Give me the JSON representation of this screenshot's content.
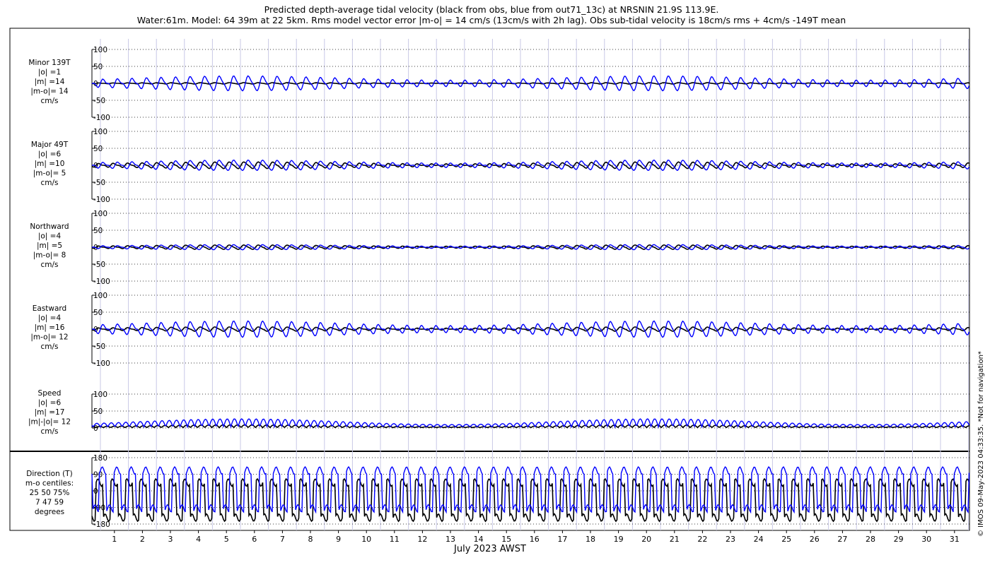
{
  "title_line1": "Predicted depth-average tidal velocity (black from obs, blue from out71_13c) at NRSNIN 21.9S 113.9E.",
  "title_line2": "Water:61m. Model: 64 39m at 22 5km. Rms model vector error |m-o| = 14 cm/s (13cm/s with 2h lag). Obs sub-tidal velocity is 18cm/s rms + 4cm/s -149T mean",
  "credit": "© IMOS 09-May-2023 04:33:35. *Not for navigation*",
  "chart_data": {
    "type": "line",
    "xlabel": "July 2023 AWST",
    "x_ticks": [
      "1",
      "2",
      "3",
      "4",
      "5",
      "6",
      "7",
      "8",
      "9",
      "10",
      "11",
      "12",
      "13",
      "14",
      "15",
      "16",
      "17",
      "18",
      "19",
      "20",
      "21",
      "22",
      "23",
      "24",
      "25",
      "26",
      "27",
      "28",
      "29",
      "30",
      "31"
    ],
    "colors": {
      "obs": "#000000",
      "model": "#0000ff",
      "grid": "#c8c8e6"
    },
    "tidal_period_hours": 12.42,
    "panels": [
      {
        "name": "minor",
        "labels": [
          "Minor 139T",
          "|o| =1",
          "|m| =14",
          "|m-o|= 14",
          "cm/s"
        ],
        "ylim": [
          -100,
          100
        ],
        "yticks": [
          "100",
          "50",
          "0",
          "-50",
          "-100"
        ],
        "obs_amplitude": 2,
        "model_amplitude": 20
      },
      {
        "name": "major",
        "labels": [
          "Major 49T",
          "|o| =6",
          "|m| =10",
          "|m-o|= 5",
          "cm/s"
        ],
        "ylim": [
          -100,
          100
        ],
        "yticks": [
          "100",
          "50",
          "0",
          "-50",
          "-100"
        ],
        "obs_amplitude": 9,
        "model_amplitude": 14
      },
      {
        "name": "northward",
        "labels": [
          "Northward",
          "|o| =4",
          "|m| =5",
          "|m-o|= 8",
          "cm/s"
        ],
        "ylim": [
          -100,
          100
        ],
        "yticks": [
          "100",
          "50",
          "0",
          "-50",
          "-100"
        ],
        "obs_amplitude": 6,
        "model_amplitude": 7
      },
      {
        "name": "eastward",
        "labels": [
          "Eastward",
          "|o| =4",
          "|m| =16",
          "|m-o|= 12",
          "cm/s"
        ],
        "ylim": [
          -100,
          100
        ],
        "yticks": [
          "100",
          "50",
          "0",
          "-50",
          "-100"
        ],
        "obs_amplitude": 6,
        "model_amplitude": 22
      },
      {
        "name": "speed",
        "labels": [
          "Speed",
          "|o| =6",
          "|m| =17",
          "|m|-|o|= 12",
          "cm/s"
        ],
        "ylim": [
          0,
          100
        ],
        "yticks": [
          "100",
          "50",
          "0"
        ],
        "obs_amplitude": 8,
        "model_amplitude": 24
      },
      {
        "name": "direction",
        "labels": [
          "Direction (T)",
          "m-o centiles:",
          "25  50  75%",
          "7  47  59",
          "degrees"
        ],
        "ylim": [
          -180,
          180
        ],
        "yticks": [
          "180",
          "90",
          "0",
          "-90",
          "-180"
        ],
        "obs_amplitude": 0,
        "model_amplitude": 0
      }
    ]
  }
}
